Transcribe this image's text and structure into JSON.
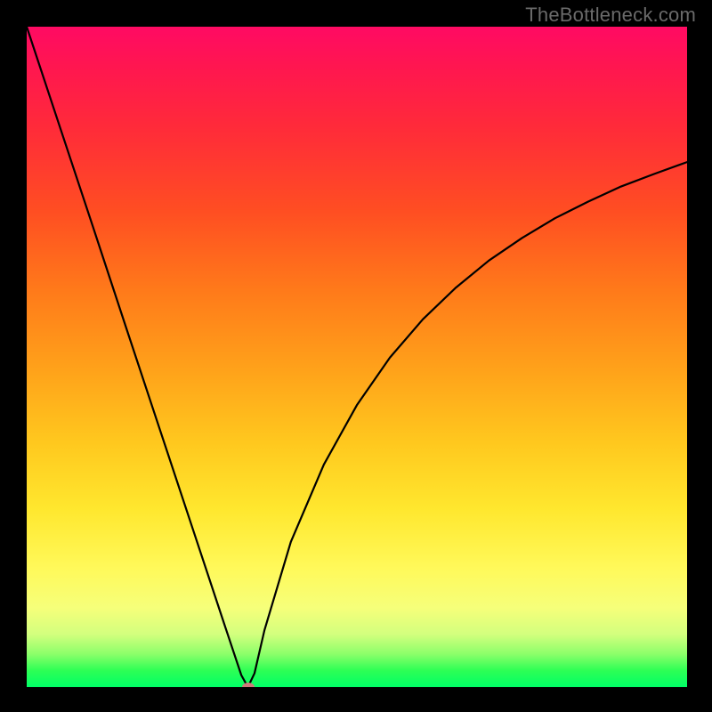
{
  "watermark": "TheBottleneck.com",
  "chart_data": {
    "type": "line",
    "title": "",
    "xlabel": "",
    "ylabel": "",
    "xlim": [
      0,
      100
    ],
    "ylim": [
      0,
      100
    ],
    "grid": false,
    "legend": false,
    "series": [
      {
        "name": "curve",
        "x": [
          0,
          5,
          10,
          15,
          20,
          25,
          30,
          32.5,
          33.5,
          34.5,
          36,
          40,
          45,
          50,
          55,
          60,
          65,
          70,
          75,
          80,
          85,
          90,
          95,
          100
        ],
        "values": [
          100,
          84.9,
          69.8,
          54.6,
          39.5,
          24.4,
          9.3,
          1.8,
          0,
          2.1,
          8.6,
          22,
          33.7,
          42.7,
          49.9,
          55.7,
          60.5,
          64.6,
          68,
          71,
          73.5,
          75.8,
          77.7,
          79.5
        ]
      }
    ],
    "annotations": [
      {
        "name": "minimum-marker",
        "shape": "ellipse",
        "x": 33.5,
        "y": 0,
        "color": "#cf7a7a"
      }
    ],
    "background_gradient": {
      "direction": "vertical",
      "stops": [
        {
          "pct": 0,
          "color": "#ff0a63"
        },
        {
          "pct": 15,
          "color": "#ff2a3a"
        },
        {
          "pct": 40,
          "color": "#ff7a1a"
        },
        {
          "pct": 63,
          "color": "#ffc81e"
        },
        {
          "pct": 82,
          "color": "#fff95a"
        },
        {
          "pct": 95,
          "color": "#8cff6a"
        },
        {
          "pct": 100,
          "color": "#00ff66"
        }
      ]
    }
  }
}
